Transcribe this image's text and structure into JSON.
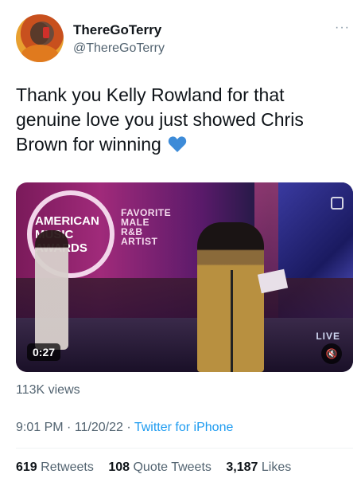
{
  "author": {
    "name": "ThereGoTerry",
    "handle": "@ThereGoTerry"
  },
  "tweet": {
    "text": "Thank you Kelly Rowland for that genuine love you just showed Chris Brown for winning",
    "emoji": "blue-heart"
  },
  "media": {
    "logo_text": "AMERICAN MUSIC AWARDS",
    "logo_lines": [
      "AMERICAN",
      "MUSIC",
      "AWARDS"
    ],
    "award_lines": [
      "FAVORITE",
      "MALE",
      "R&B",
      "ARTIST"
    ],
    "live_label": "LIVE",
    "duration": "0:27",
    "mute_icon": "speaker-muted-icon",
    "gif_icon": "media-corner-icon"
  },
  "views": "113K views",
  "meta": {
    "time": "9:01 PM",
    "date": "11/20/22",
    "separator": "·",
    "source": "Twitter for iPhone"
  },
  "stats": {
    "retweets_count": "619",
    "retweets_label": "Retweets",
    "quotes_count": "108",
    "quotes_label": "Quote Tweets",
    "likes_count": "3,187",
    "likes_label": "Likes"
  },
  "colors": {
    "accent": "#1d9bf0",
    "secondary_text": "#536471",
    "primary_text": "#0f1419",
    "heart": "#3d8bd8"
  }
}
